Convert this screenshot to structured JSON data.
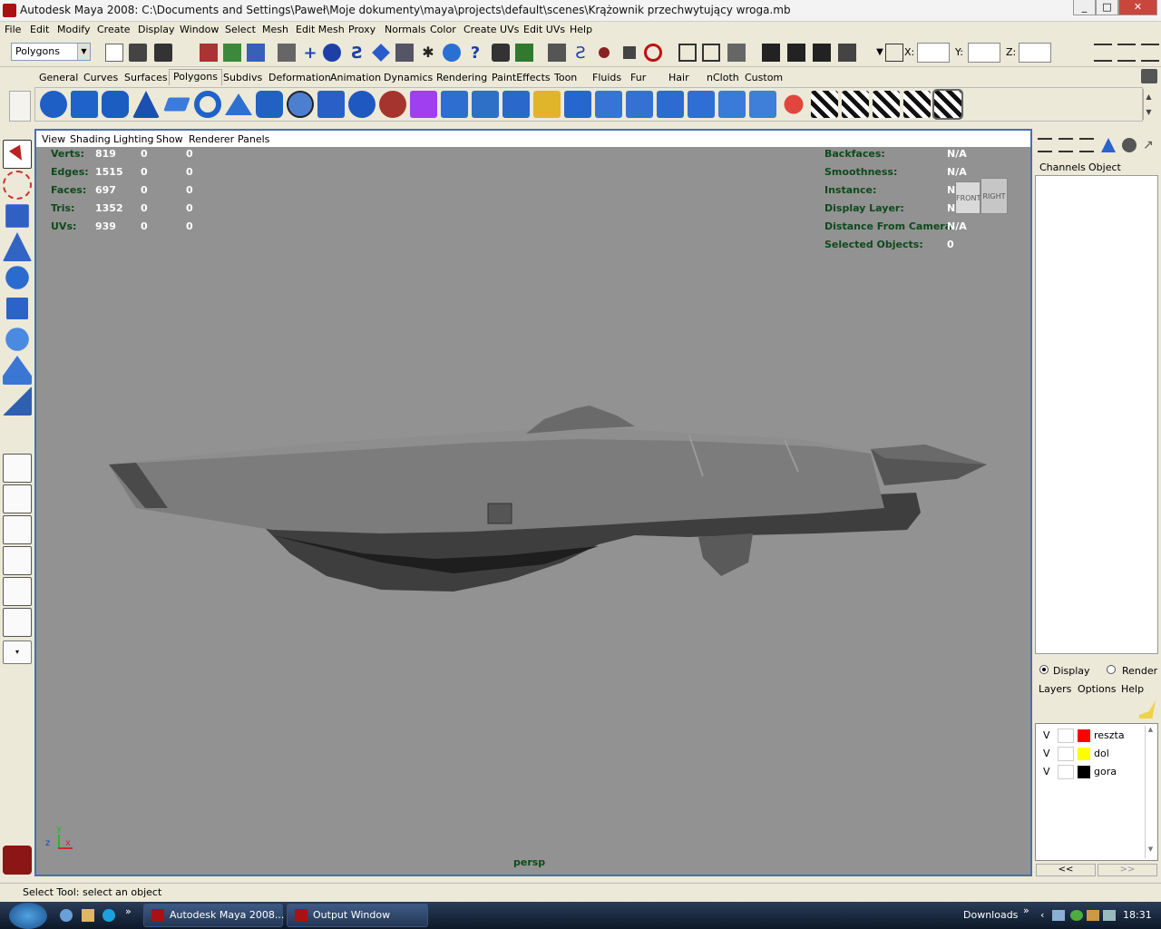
{
  "window": {
    "title": "Autodesk Maya 2008: C:\\Documents and Settings\\Paweł\\Moje dokumenty\\maya\\projects\\default\\scenes\\Krążownik przechwytujący wroga.mb",
    "min": "_",
    "max": "□",
    "close": "✕"
  },
  "menubar": [
    "File",
    "Edit",
    "Modify",
    "Create",
    "Display",
    "Window",
    "Select",
    "Mesh",
    "Edit Mesh",
    "Proxy",
    "Normals",
    "Color",
    "Create UVs",
    "Edit UVs",
    "Help"
  ],
  "statusline": {
    "menuset": "Polygons",
    "x_label": "X:",
    "y_label": "Y:",
    "z_label": "Z:"
  },
  "shelf_tabs": [
    "General",
    "Curves",
    "Surfaces",
    "Polygons",
    "Subdivs",
    "Deformation",
    "Animation",
    "Dynamics",
    "Rendering",
    "PaintEffects",
    "Toon",
    "Fluids",
    "Fur",
    "Hair",
    "nCloth",
    "Custom"
  ],
  "shelf_active": "Polygons",
  "panel_menu": [
    "View",
    "Shading",
    "Lighting",
    "Show",
    "Renderer",
    "Panels"
  ],
  "hud_left": [
    {
      "label": "Verts:",
      "v1": "819",
      "v2": "0",
      "v3": "0"
    },
    {
      "label": "Edges:",
      "v1": "1515",
      "v2": "0",
      "v3": "0"
    },
    {
      "label": "Faces:",
      "v1": "697",
      "v2": "0",
      "v3": "0"
    },
    {
      "label": "Tris:",
      "v1": "1352",
      "v2": "0",
      "v3": "0"
    },
    {
      "label": "UVs:",
      "v1": "939",
      "v2": "0",
      "v3": "0"
    }
  ],
  "hud_right": [
    {
      "label": "Backfaces:",
      "value": "N/A"
    },
    {
      "label": "Smoothness:",
      "value": "N/A"
    },
    {
      "label": "Instance:",
      "value": "N/A"
    },
    {
      "label": "Display Layer:",
      "value": "N/A"
    },
    {
      "label": "Distance From Camera:",
      "value": "N/A"
    },
    {
      "label": "Selected Objects:",
      "value": "0"
    }
  ],
  "viewcube": {
    "front": "FRONT",
    "right": "RIGHT"
  },
  "camera_label": "persp",
  "axis": {
    "x": "x",
    "y": "y",
    "z": "z"
  },
  "channel_box": {
    "tabs": [
      "Channels",
      "Object"
    ]
  },
  "layer_editor": {
    "display_label": "Display",
    "render_label": "Render",
    "menu": [
      "Layers",
      "Options",
      "Help"
    ],
    "layers": [
      {
        "visible": "V",
        "name": "reszta",
        "color": "#ff0000"
      },
      {
        "visible": "V",
        "name": "dol",
        "color": "#ffff00"
      },
      {
        "visible": "V",
        "name": "gora",
        "color": "#000000"
      }
    ],
    "nav_left": "<<",
    "nav_right": ">>"
  },
  "help_line": "Select Tool: select an object",
  "taskbar": {
    "items": [
      "Autodesk Maya 2008...",
      "Output Window"
    ],
    "downloads": "Downloads",
    "chevron": "»",
    "clock": "18:31"
  }
}
